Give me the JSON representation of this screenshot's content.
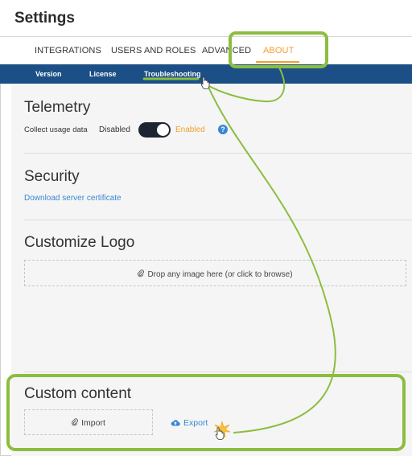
{
  "header": {
    "title": "Settings"
  },
  "tabs": [
    {
      "label": "INTEGRATIONS",
      "active": false
    },
    {
      "label": "USERS AND ROLES",
      "active": false
    },
    {
      "label": "ADVANCED",
      "active": false
    },
    {
      "label": "ABOUT",
      "active": true
    }
  ],
  "subtabs": [
    {
      "label": "Version"
    },
    {
      "label": "License"
    },
    {
      "label": "Troubleshooting"
    }
  ],
  "telemetry": {
    "heading": "Telemetry",
    "usage_label": "Collect usage data",
    "off_label": "Disabled",
    "on_label": "Enabled",
    "enabled": true,
    "help": "?"
  },
  "security": {
    "heading": "Security",
    "download_link": "Download server certificate"
  },
  "logo": {
    "heading": "Customize Logo",
    "dropzone_text": "Drop any image here (or click to browse)",
    "icon": "paperclip-icon"
  },
  "custom_content": {
    "heading": "Custom content",
    "import_label": "Import",
    "export_label": "Export",
    "import_icon": "paperclip-icon",
    "export_icon": "cloud-upload-icon"
  },
  "colors": {
    "accent": "#f0a030",
    "nav": "#1b4f86",
    "link": "#3a86d4",
    "annotation": "#8cbd3f"
  }
}
